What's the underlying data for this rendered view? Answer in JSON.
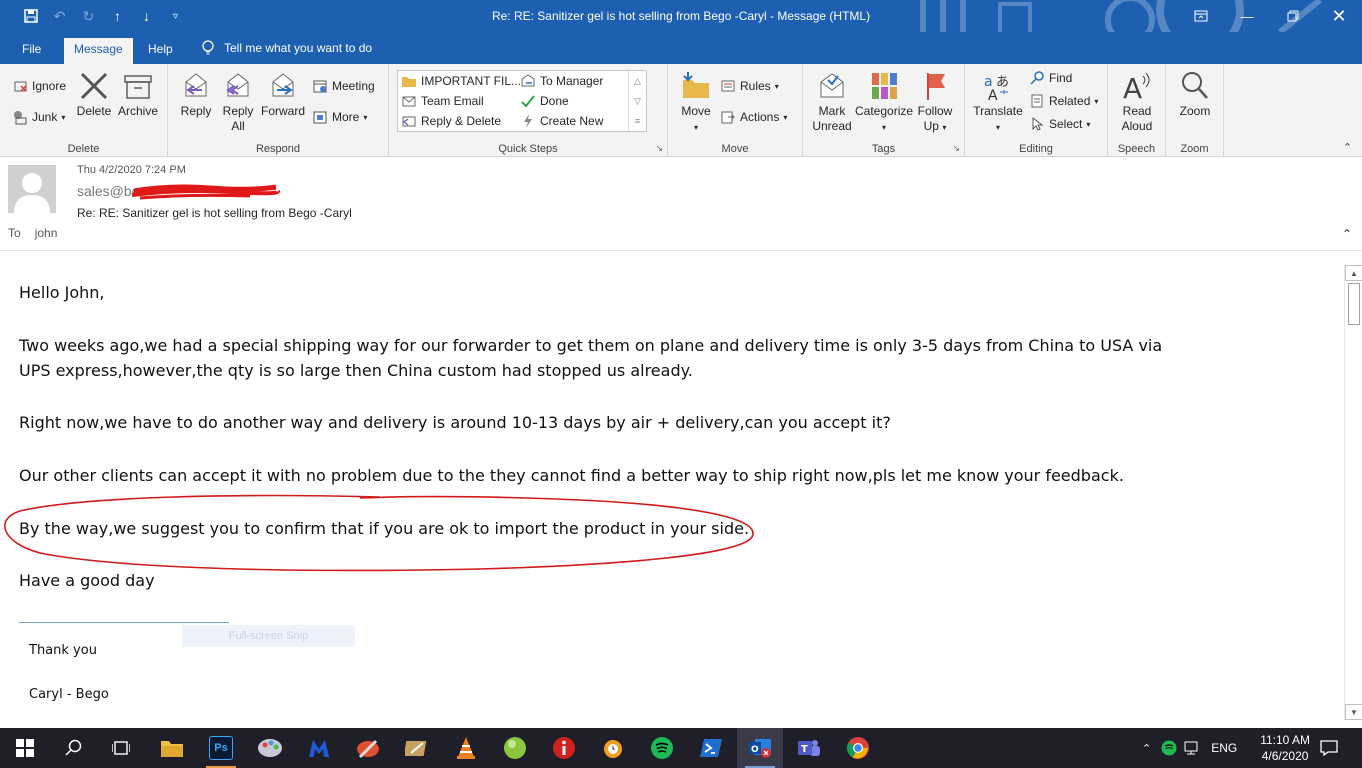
{
  "window": {
    "title": "Re: RE: Sanitizer gel is hot selling from Bego -Caryl  -  Message (HTML)"
  },
  "menu": {
    "tabs": [
      "File",
      "Message",
      "Help"
    ],
    "active_tab": "Message",
    "tell_me": "Tell me what you want to do"
  },
  "ribbon": {
    "delete": {
      "label": "Delete",
      "ignore": "Ignore",
      "junk": "Junk",
      "delete": "Delete",
      "archive": "Archive"
    },
    "respond": {
      "label": "Respond",
      "reply": "Reply",
      "reply_all_1": "Reply",
      "reply_all_2": "All",
      "forward": "Forward",
      "meeting": "Meeting",
      "more": "More"
    },
    "quick_steps": {
      "label": "Quick Steps",
      "items": [
        "IMPORTANT FIL...",
        "To Manager",
        "Team Email",
        "Done",
        "Reply & Delete",
        "Create New"
      ]
    },
    "move": {
      "label": "Move",
      "move": "Move",
      "rules": "Rules",
      "actions": "Actions"
    },
    "tags": {
      "label": "Tags",
      "mark_unread_1": "Mark",
      "mark_unread_2": "Unread",
      "categorize": "Categorize",
      "follow_up_1": "Follow",
      "follow_up_2": "Up"
    },
    "editing": {
      "label": "Editing",
      "translate": "Translate",
      "find": "Find",
      "related": "Related",
      "select": "Select"
    },
    "speech": {
      "label": "Speech",
      "read_aloud_1": "Read",
      "read_aloud_2": "Aloud"
    },
    "zoom": {
      "label": "Zoom",
      "zoom": "Zoom"
    }
  },
  "message": {
    "date": "Thu 4/2/2020 7:24 PM",
    "from": "sales@be",
    "subject": "Re: RE: Sanitizer gel is hot selling from Bego -Caryl",
    "to_label": "To",
    "to": "john",
    "paragraphs": [
      "Hello John,",
      "Two weeks ago,we had a special shipping way for our forwarder to get them on plane and delivery time is only 3-5 days from China to USA via UPS express,however,the qty is so large then China custom had stopped us already.",
      "Right now,we have to do another way and delivery is around 10-13 days by air + delivery,can you accept it?",
      "Our other clients can accept it with no problem due to the they cannot find a better way to ship right now,pls let me know your feedback.",
      "By the way,we suggest you to confirm that if you are ok to import the product in your side.",
      "Have a good day"
    ],
    "snip_overlay": "Full-screen Snip",
    "signature": [
      "Thank you",
      "Caryl - Bego"
    ]
  },
  "taskbar": {
    "language": "ENG",
    "time": "11:10 AM",
    "date": "4/6/2020"
  },
  "colors": {
    "titlebar": "#1d5fb0",
    "ribbon": "#f3f3f3",
    "annotation": "#d11a1a",
    "taskbar": "#1f1f2a"
  }
}
